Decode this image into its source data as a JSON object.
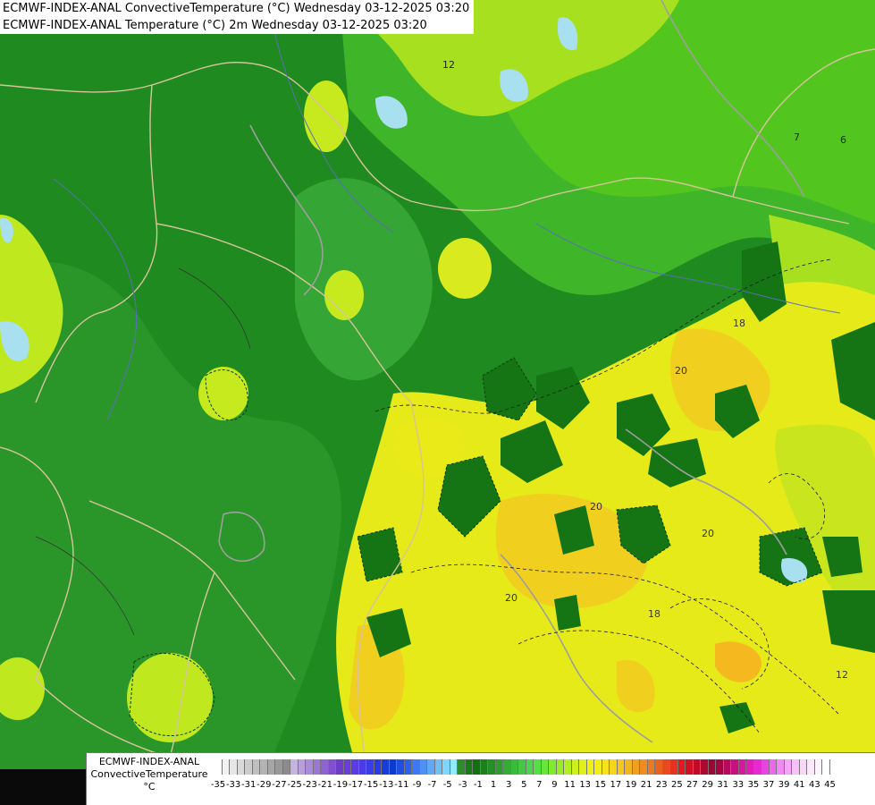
{
  "titles": {
    "line1": "ECMWF-INDEX-ANAL ConvectiveTemperature (°C) Wednesday 03-12-2025 03:20",
    "line2": "ECMWF-INDEX-ANAL Temperature (°C) 2m Wednesday 03-12-2025 03:20"
  },
  "legend": {
    "title_line1": "ECMWF-INDEX-ANAL",
    "title_line2": "ConvectiveTemperature",
    "unit": "°C",
    "tick_labels": [
      "-35",
      "-33",
      "-31",
      "-29",
      "-27",
      "-25",
      "-23",
      "-21",
      "-19",
      "-17",
      "-15",
      "-13",
      "-11",
      "-9",
      "-7",
      "-5",
      "-3",
      "-1",
      "1",
      "3",
      "5",
      "7",
      "9",
      "11",
      "13",
      "15",
      "17",
      "19",
      "21",
      "23",
      "25",
      "27",
      "29",
      "31",
      "33",
      "35",
      "37",
      "39",
      "41",
      "43",
      "45"
    ]
  },
  "contour_labels": [
    {
      "text": "12",
      "color": "#222222"
    },
    {
      "text": "6",
      "color": "#222222"
    },
    {
      "text": "7",
      "color": "#222222"
    },
    {
      "text": "18",
      "color": "#333333"
    },
    {
      "text": "20",
      "color": "#333333"
    },
    {
      "text": "20",
      "color": "#333333"
    },
    {
      "text": "20",
      "color": "#333333"
    },
    {
      "text": "20",
      "color": "#333333"
    },
    {
      "text": "18",
      "color": "#333333"
    },
    {
      "text": "12",
      "color": "#333333"
    }
  ],
  "colors": {
    "dark_green": "#1f8a1f",
    "mid_green": "#35a535",
    "bright_green": "#55cc22",
    "lime": "#bfe81f",
    "yellow": "#ecec1a",
    "gold": "#f3cc1f",
    "lake": "#a8e0f0",
    "background": "#0a0a0a"
  }
}
